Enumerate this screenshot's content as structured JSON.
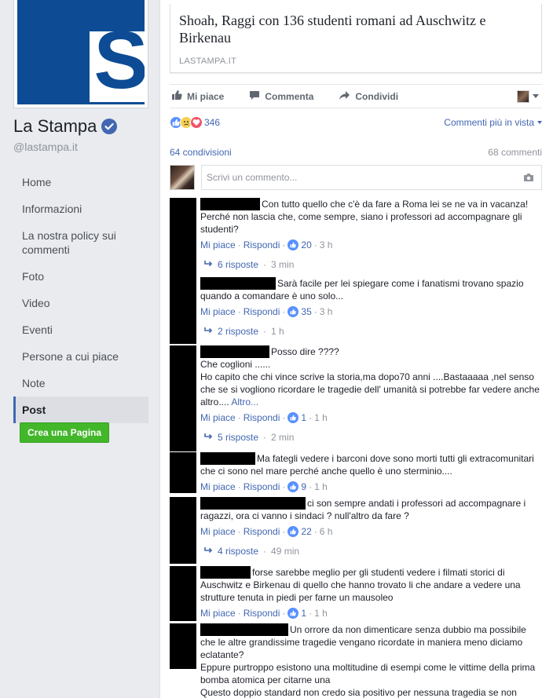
{
  "page": {
    "name": "La Stampa",
    "handle": "@lastampa.it",
    "logo_letter": "S",
    "brand_color": "#0d4c94"
  },
  "nav": [
    {
      "label": "Home",
      "active": false
    },
    {
      "label": "Informazioni",
      "active": false
    },
    {
      "label": "La nostra policy sui commenti",
      "active": false
    },
    {
      "label": "Foto",
      "active": false
    },
    {
      "label": "Video",
      "active": false
    },
    {
      "label": "Eventi",
      "active": false
    },
    {
      "label": "Persone a cui piace",
      "active": false
    },
    {
      "label": "Note",
      "active": false
    },
    {
      "label": "Post",
      "active": true
    }
  ],
  "create_page_label": "Crea una Pagina",
  "post": {
    "link_title": "Shoah, Raggi con 136 studenti romani ad Auschwitz e Birkenau",
    "link_domain": "LASTAMPA.IT",
    "actions": {
      "like": "Mi piace",
      "comment": "Commenta",
      "share": "Condividi"
    },
    "reactions_count": "346",
    "sort_label": "Commenti più in vista",
    "shares": "64 condivisioni",
    "comments_count": "68 commenti",
    "composer_placeholder": "Scrivi un commento..."
  },
  "comment_labels": {
    "like": "Mi piace",
    "reply": "Rispondi"
  },
  "comments": [
    {
      "text": [
        "Con tutto quello che c'è da fare a Roma lei se ne va in vacanza!",
        "Perché non lascia che, come sempre, siano i professori ad accompagnare gli studenti?"
      ],
      "likes": "20",
      "time": "3 h",
      "replies": "6 risposte",
      "replies_time": "3 min"
    },
    {
      "text": [
        "Sarà facile per lei spiegare come i fanatismi trovano spazio quando a comandare è uno solo..."
      ],
      "likes": "35",
      "time": "3 h",
      "replies": "2 risposte",
      "replies_time": "1 h"
    },
    {
      "text": [
        "Posso dire ????",
        "Che coglioni ......",
        "Ho capito che chi vince scrive la storia,ma dopo70 anni ....Bastaaaaa ,nel senso che se si vogliono ricordare le tragedie dell' umanità si potrebbe far vedere anche altro...."
      ],
      "more": "Altro...",
      "likes": "1",
      "time": "1 h",
      "replies": "5 risposte",
      "replies_time": "2 min"
    },
    {
      "text": [
        "Ma fategli vedere i barconi dove sono morti tutti gli extracomunitari che ci sono nel mare perché anche quello è uno sterminio...."
      ],
      "likes": "9",
      "time": "1 h"
    },
    {
      "text": [
        "ci son sempre andati i professori ad accompagnare i ragazzi, ora ci vanno i sindaci ? null'altro da fare ?"
      ],
      "likes": "22",
      "time": "6 h",
      "replies": "4 risposte",
      "replies_time": "49 min"
    },
    {
      "text": [
        "forse sarebbe meglio per gli studenti vedere i filmati storici di Auschwitz e Birkenau di quello che hanno trovato li che andare a vedere una strutture tenuta in piedi per farne un mausoleo"
      ],
      "likes": "1",
      "time": "1 h"
    },
    {
      "text": [
        "Un orrore da non dimenticare senza dubbio ma possibile che le altre grandissime tragedie vengano ricordate in maniera meno diciamo eclatante?",
        "Eppure purtroppo esistono una moltitudine di esempi come le vittime della prima bomba atomica per citarne una",
        "Questo doppio standard non credo sia positivo per nessuna tragedia se non"
      ]
    }
  ]
}
